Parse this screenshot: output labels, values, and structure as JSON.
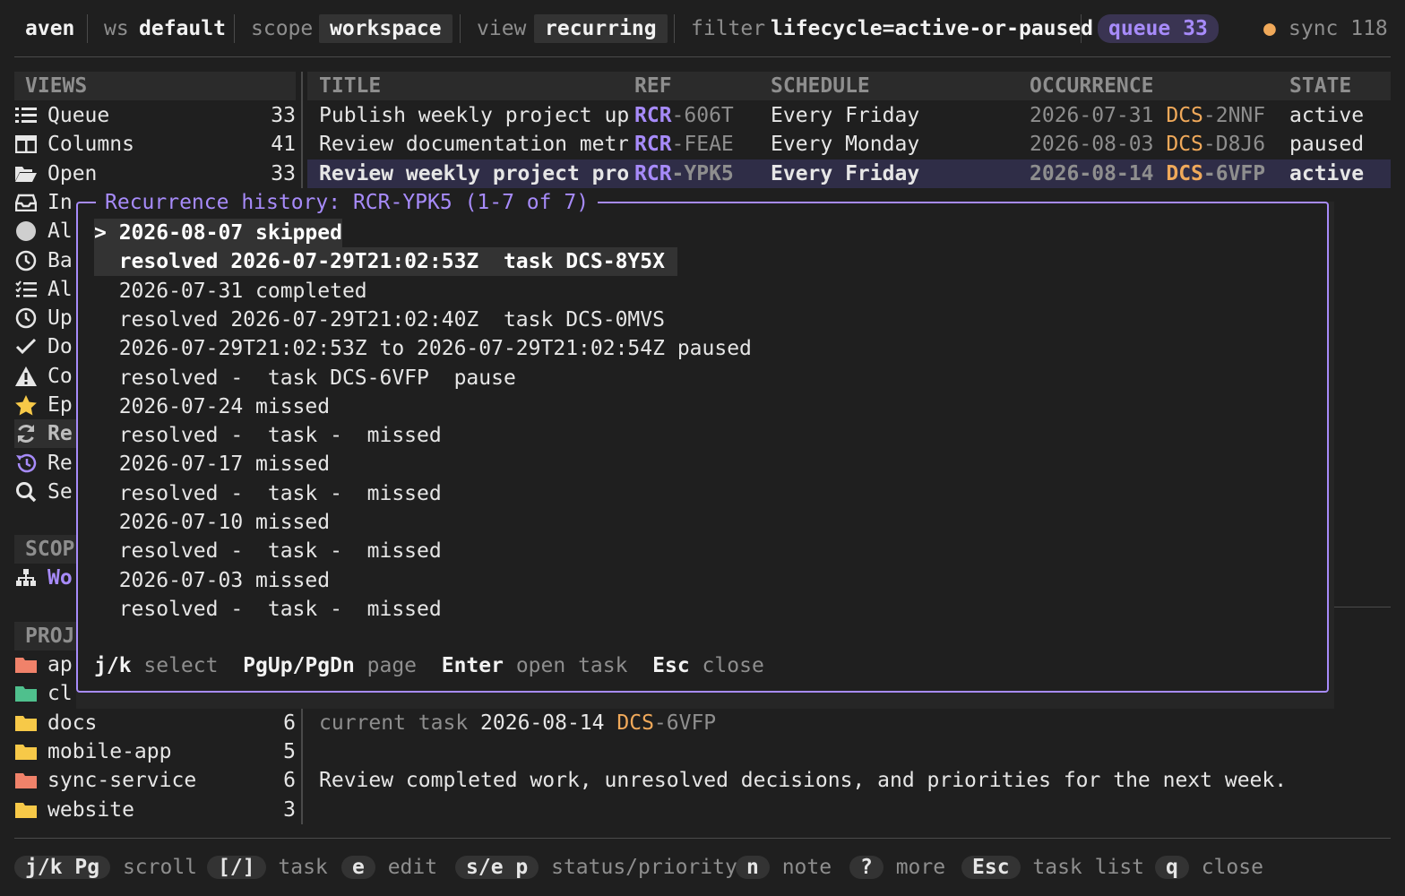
{
  "header": {
    "app": "aven",
    "ws_label": "ws",
    "ws_value": "default",
    "scope_label": "scope",
    "scope_value": "workspace",
    "view_label": "view",
    "view_value": "recurring",
    "filter_label": "filter",
    "filter_value": "lifecycle=active-or-paused",
    "queue_label": "queue",
    "queue_count": "33",
    "sync_label": "sync 118",
    "sync_dot_color": "#f0a95a"
  },
  "sidebar": {
    "views_header": "VIEWS",
    "views": [
      {
        "icon": "list-icon",
        "label": "Queue",
        "count": "33"
      },
      {
        "icon": "columns-icon",
        "label": "Columns",
        "count": "41"
      },
      {
        "icon": "folder-open-icon",
        "label": "Open",
        "count": "33"
      },
      {
        "icon": "inbox-icon",
        "label": "In",
        "count": ""
      },
      {
        "icon": "circle-icon",
        "label": "Al",
        "count": ""
      },
      {
        "icon": "clock-icon",
        "label": "Ba",
        "count": ""
      },
      {
        "icon": "checklist-icon",
        "label": "Al",
        "count": ""
      },
      {
        "icon": "clock-icon",
        "label": "Up",
        "count": ""
      },
      {
        "icon": "check-icon",
        "label": "Do",
        "count": ""
      },
      {
        "icon": "warning-icon",
        "label": "Co",
        "count": ""
      },
      {
        "icon": "star-icon",
        "label": "Ep",
        "count": ""
      },
      {
        "icon": "refresh-icon",
        "label": "Re",
        "count": ""
      },
      {
        "icon": "history-icon",
        "label": "Re",
        "count": ""
      },
      {
        "icon": "search-icon",
        "label": "Se",
        "count": ""
      }
    ],
    "scope_header": "SCOP",
    "scope_item": {
      "icon": "hierarchy-icon",
      "label": "Wo"
    },
    "projects_header": "PROJ",
    "projects": [
      {
        "label": "ap",
        "count": "",
        "color": "#f0826a"
      },
      {
        "label": "cl",
        "count": "",
        "color": "#4fc08d"
      },
      {
        "label": "docs",
        "count": "6",
        "color": "#f7c948"
      },
      {
        "label": "mobile-app",
        "count": "5",
        "color": "#f7c948"
      },
      {
        "label": "sync-service",
        "count": "6",
        "color": "#f0826a"
      },
      {
        "label": "website",
        "count": "3",
        "color": "#f7c948"
      }
    ]
  },
  "table": {
    "columns": [
      "TITLE",
      "REF",
      "SCHEDULE",
      "OCCURRENCE",
      "STATE"
    ],
    "rows": [
      {
        "title": "Publish weekly project upda",
        "ref_prefix": "RCR",
        "ref_id": "-606T",
        "schedule": "Every Friday",
        "occ_date": "2026-07-31",
        "occ_prefix": "DCS",
        "occ_id": "-2NNF",
        "state": "active"
      },
      {
        "title": "Review documentation metric",
        "ref_prefix": "RCR",
        "ref_id": "-FEAE",
        "schedule": "Every Monday",
        "occ_date": "2026-08-03",
        "occ_prefix": "DCS",
        "occ_id": "-D8J6",
        "state": "paused"
      },
      {
        "title": "Review weekly project progr",
        "ref_prefix": "RCR",
        "ref_id": "-YPK5",
        "schedule": "Every Friday",
        "occ_date": "2026-08-14",
        "occ_prefix": "DCS",
        "occ_id": "-6VFP",
        "state": "active"
      }
    ]
  },
  "detail": {
    "current_task_label": "current task",
    "current_task_date": "2026-08-14",
    "current_task_prefix": "DCS",
    "current_task_id": "-6VFP",
    "description": "Review completed work, unresolved decisions, and priorities for the next week."
  },
  "modal": {
    "title": "Recurrence history: RCR-YPK5 (1-7 of 7)",
    "lines": [
      "> 2026-08-07 skipped",
      "  resolved 2026-07-29T21:02:53Z  task DCS-8Y5X ",
      "  2026-07-31 completed",
      "  resolved 2026-07-29T21:02:40Z  task DCS-0MVS",
      "  2026-07-29T21:02:53Z to 2026-07-29T21:02:54Z paused",
      "  resolved -  task DCS-6VFP  pause",
      "  2026-07-24 missed",
      "  resolved -  task -  missed",
      "  2026-07-17 missed",
      "  resolved -  task -  missed",
      "  2026-07-10 missed",
      "  resolved -  task -  missed",
      "  2026-07-03 missed",
      "  resolved -  task -  missed"
    ],
    "hints": [
      {
        "key": "j/k",
        "label": "select"
      },
      {
        "key": "PgUp/PgDn",
        "label": "page"
      },
      {
        "key": "Enter",
        "label": "open task"
      },
      {
        "key": "Esc",
        "label": "close"
      }
    ]
  },
  "footer": [
    {
      "key": "j/k Pg",
      "label": "scroll"
    },
    {
      "key": "[/]",
      "label": "task"
    },
    {
      "key": "e",
      "label": "edit"
    },
    {
      "key": "s/e p",
      "label": "status/priority"
    },
    {
      "key": "n",
      "label": "note"
    },
    {
      "key": "?",
      "label": "more"
    },
    {
      "key": "Esc",
      "label": "task list"
    },
    {
      "key": "q",
      "label": "close"
    }
  ]
}
